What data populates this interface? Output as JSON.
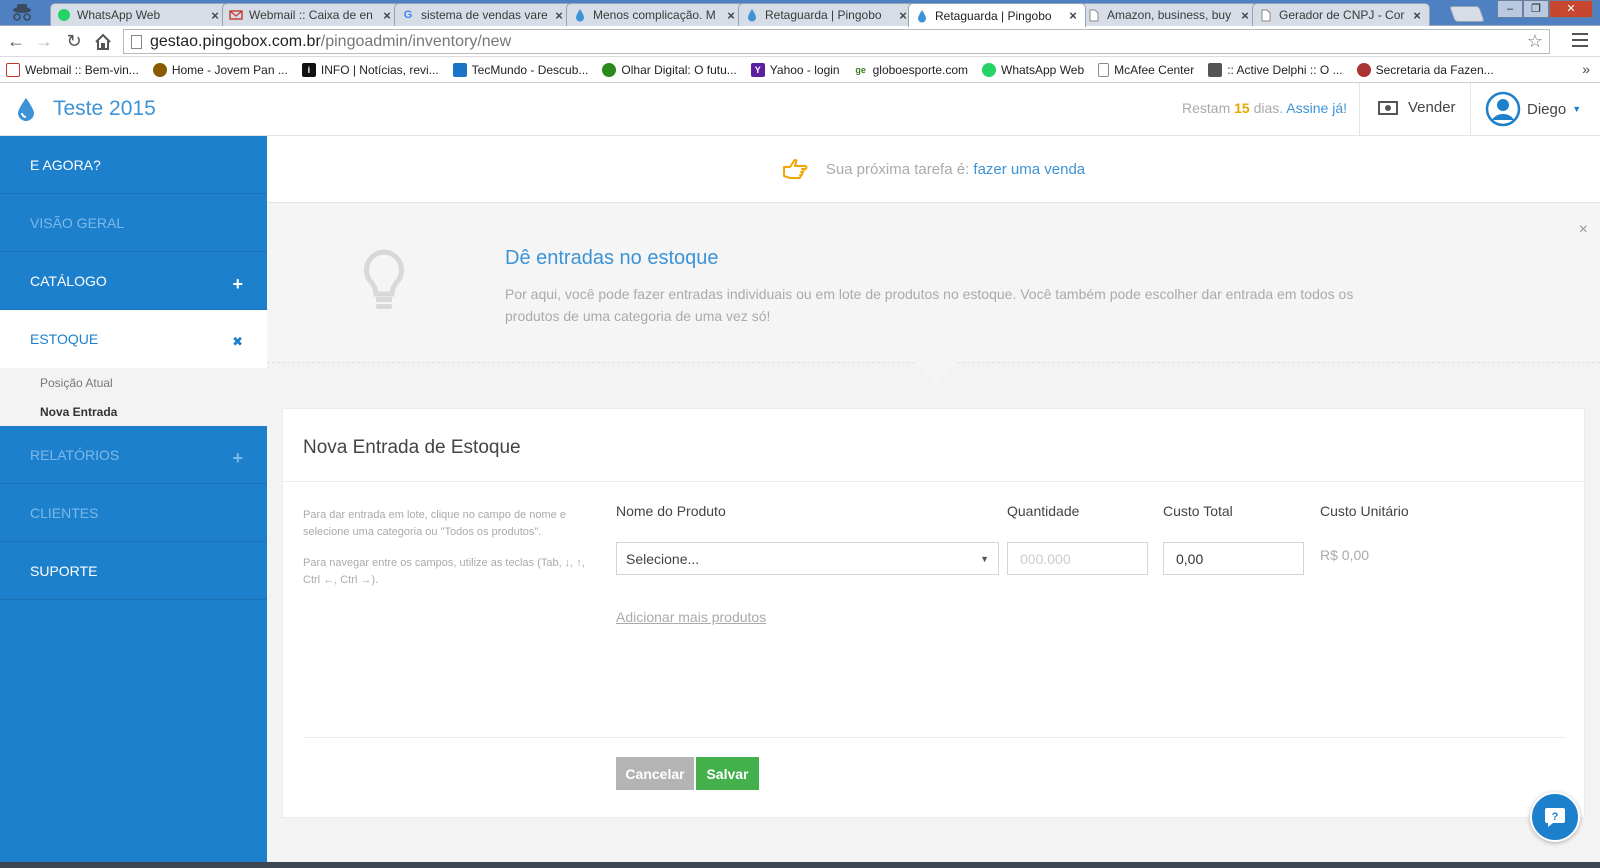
{
  "browser": {
    "tabs": [
      {
        "title": "WhatsApp Web",
        "favicon": "whatsapp-icon",
        "color": "#25d366"
      },
      {
        "title": "Webmail :: Caixa de en",
        "favicon": "mail-icon",
        "color": "#c0392b"
      },
      {
        "title": "sistema de vendas vare",
        "favicon": "google-icon",
        "color": "#4285f4"
      },
      {
        "title": "Menos complicação. M",
        "favicon": "drop-icon",
        "color": "#3d93d6"
      },
      {
        "title": "Retaguarda | Pingobo",
        "favicon": "drop-icon",
        "color": "#3d93d6"
      },
      {
        "title": "Retaguarda | Pingobo",
        "favicon": "drop-icon",
        "color": "#3d93d6",
        "active": true
      },
      {
        "title": "Amazon, business, buy",
        "favicon": "page-icon",
        "color": "#888888"
      },
      {
        "title": "Gerador de CNPJ - Cor",
        "favicon": "page-icon",
        "color": "#888888"
      }
    ],
    "url_host": "gestao.pingobox.com.br",
    "url_path": "/pingoadmin/inventory/new",
    "bookmarks": [
      {
        "label": "Webmail :: Bem-vin...",
        "icon": "mail-icon",
        "color": "#c0392b"
      },
      {
        "label": "Home - Jovem Pan ...",
        "icon": "jovem-pan-icon",
        "color": "#8a5a00"
      },
      {
        "label": "INFO | Notícias, revi...",
        "icon": "info-icon",
        "color": "#111111"
      },
      {
        "label": "TecMundo - Descub...",
        "icon": "tecmundo-icon",
        "color": "#1b74c5"
      },
      {
        "label": "Olhar Digital: O futu...",
        "icon": "olhar-digital-icon",
        "color": "#2b8a1e"
      },
      {
        "label": "Yahoo - login",
        "icon": "yahoo-icon",
        "color": "#5c1fa0"
      },
      {
        "label": "globoesporte.com",
        "icon": "ge-icon",
        "color": "#3a7d22"
      },
      {
        "label": "WhatsApp Web",
        "icon": "whatsapp-icon",
        "color": "#25d366"
      },
      {
        "label": "McAfee Center",
        "icon": "page-icon",
        "color": "#888888"
      },
      {
        "label": ":: Active Delphi :: O ...",
        "icon": "delphi-icon",
        "color": "#555555"
      },
      {
        "label": "Secretaria da Fazen...",
        "icon": "fazenda-icon",
        "color": "#a33"
      }
    ],
    "bookmarks_more": "»"
  },
  "header": {
    "title": "Teste 2015",
    "trial_prefix": "Restam",
    "trial_days": "15",
    "trial_suffix": "dias.",
    "trial_link": "Assine já!",
    "sell_label": "Vender",
    "user_name": "Diego"
  },
  "sidebar": {
    "items": [
      {
        "label": "E AGORA?",
        "toggle": ""
      },
      {
        "label": "VISÃO GERAL",
        "toggle": ""
      },
      {
        "label": "CATÁLOGO",
        "toggle": "+"
      },
      {
        "label": "ESTOQUE",
        "toggle": "✖"
      },
      {
        "label": "RELATÓRIOS",
        "toggle": "+"
      },
      {
        "label": "CLIENTES",
        "toggle": ""
      },
      {
        "label": "SUPORTE",
        "toggle": ""
      }
    ],
    "sub_items": [
      "Posição Atual",
      "Nova Entrada"
    ]
  },
  "task": {
    "prefix": "Sua próxima tarefa é:",
    "link": "fazer uma venda"
  },
  "info": {
    "title": "Dê entradas no estoque",
    "description": "Por aqui, você pode fazer entradas individuais ou em lote de produtos no estoque. Você também pode escolher dar entrada em todos os produtos de uma categoria de uma vez só!",
    "close": "×"
  },
  "form": {
    "title": "Nova Entrada de Estoque",
    "help_1": "Para dar entrada em lote, clique no campo de nome e selecione uma categoria ou \"Todos os produtos\".",
    "help_2": "Para navegar entre os campos, utilize as teclas (Tab, ↓, ↑, Ctrl ←, Ctrl →).",
    "col_product": "Nome do Produto",
    "col_quantity": "Quantidade",
    "col_total_cost": "Custo Total",
    "col_unit_cost": "Custo Unitário",
    "product_value": "Selecione...",
    "quantity_placeholder": "000.000",
    "total_cost_value": "0,00",
    "unit_cost_value": "R$ 0,00",
    "add_more": "Adicionar mais produtos",
    "cancel": "Cancelar",
    "save": "Salvar"
  },
  "colors": {
    "brand_blue": "#1d80cc",
    "link_blue": "#3d93d6",
    "save_green": "#43b04b",
    "trial_gold": "#e6a800"
  }
}
